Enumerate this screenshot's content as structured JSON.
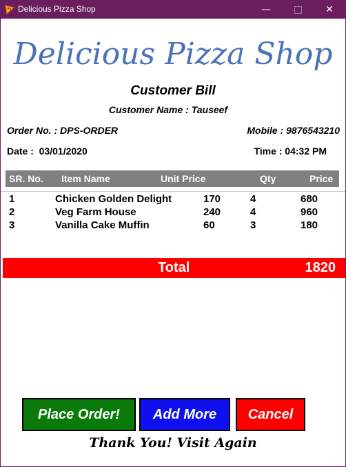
{
  "window": {
    "title": "Delicious Pizza Shop",
    "minimize": "—",
    "close": "✕",
    "title_color": "#6b1e5e"
  },
  "bill": {
    "shop_name": "Delicious Pizza Shop",
    "heading": "Customer Bill",
    "customer_name": "Customer Name : Tauseef",
    "order_no": "Order No. : DPS-ORDER",
    "mobile": "Mobile : 9876543210",
    "date": "Date :  03/01/2020",
    "time": "Time : 04:32 PM"
  },
  "table": {
    "headers": [
      "SR. No.",
      "Item Name",
      "Unit Price",
      "Qty",
      "Price"
    ],
    "rows": [
      [
        "1",
        "Chicken Golden Delight",
        "170",
        "4",
        "680"
      ],
      [
        "2",
        "Veg Farm House",
        "240",
        "4",
        "960"
      ],
      [
        "3",
        "Vanilla Cake Muffin",
        "60",
        "3",
        "180"
      ]
    ]
  },
  "total": {
    "label": "Total",
    "value": "1820"
  },
  "actions": {
    "place_order": "Place Order!",
    "add_more": "Add More",
    "cancel": "Cancel"
  },
  "footer": {
    "thanks": "Thank You! Visit Again"
  },
  "colors": {
    "shop_title": "#4a72b8",
    "header_bg": "#808080",
    "total_bg": "#ff0000",
    "place_order_bg": "#0a7a0a",
    "add_more_bg": "#1010ee",
    "cancel_bg": "#ff0000"
  }
}
